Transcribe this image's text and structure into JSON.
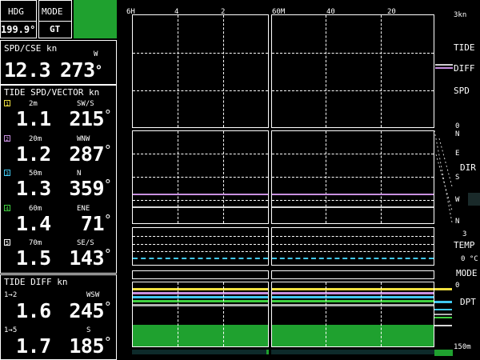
{
  "header": {
    "hdg_label": "HDG",
    "hdg_value": "199.9°",
    "mode_label": "MODE",
    "mode_value": "GT",
    "accent_color": "#1fa12f"
  },
  "spd_cse": {
    "label": "SPD/CSE  kn",
    "dir": "W",
    "speed": "12.3",
    "course": "273",
    "deg": "°"
  },
  "tide_vector": {
    "title": "TIDE SPD/VECTOR kn",
    "layers": [
      {
        "num": "1",
        "depth": "2m",
        "dir": "SW/S",
        "speed": "1.1",
        "course": "215",
        "color": "#f0e040"
      },
      {
        "num": "2",
        "depth": "20m",
        "dir": "WNW",
        "speed": "1.2",
        "course": "287",
        "color": "#c890e0"
      },
      {
        "num": "3",
        "depth": "50m",
        "dir": "N",
        "speed": "1.3",
        "course": "359",
        "color": "#40c8f0"
      },
      {
        "num": "4",
        "depth": "60m",
        "dir": "ENE",
        "speed": "1.4",
        "course": "71",
        "color": "#40d040"
      },
      {
        "num": "5",
        "depth": "70m",
        "dir": "SE/S",
        "speed": "1.5",
        "course": "143",
        "color": "#ffffff"
      }
    ]
  },
  "tide_diff": {
    "title": "TIDE DIFF kn",
    "rows": [
      {
        "pair": "1→2",
        "dir": "WSW",
        "speed": "1.6",
        "course": "245"
      },
      {
        "pair": "1→5",
        "dir": "S",
        "speed": "1.7",
        "course": "185"
      }
    ]
  },
  "graph": {
    "top_ticks_left": [
      "6H",
      "4",
      "2"
    ],
    "top_ticks_right": [
      "60M",
      "40",
      "20"
    ],
    "range_top": "3kn",
    "labels": {
      "tide": "TIDE",
      "diff": "DIFF",
      "spd": "SPD",
      "spd_zero": "0",
      "dir": "DIR",
      "dir_ticks": [
        "N",
        "E",
        "S",
        "W",
        "N"
      ],
      "temp": "TEMP",
      "temp_top": "3",
      "temp_bottom": "0 °C",
      "mode": "MODE",
      "dpt": "DPT",
      "dpt_top": "0",
      "dpt_bottom": "150m"
    }
  }
}
